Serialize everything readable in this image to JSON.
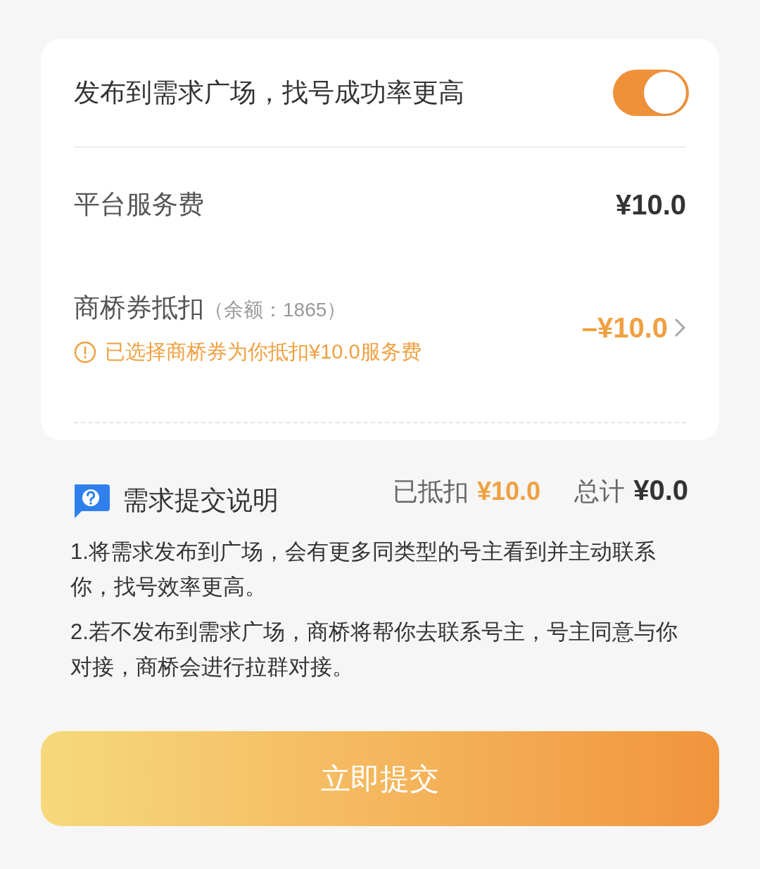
{
  "toggle_row": {
    "label": "发布到需求广场，找号成功率更高",
    "on": true
  },
  "fee_row": {
    "label": "平台服务费",
    "value": "¥10.0"
  },
  "coupon_row": {
    "label": "商桥券抵扣",
    "balance": "（余额：1865）",
    "notice": "已选择商桥券为你抵扣¥10.0服务费",
    "value": "–¥10.0"
  },
  "summary": {
    "help_title": "需求提交说明",
    "deducted_label": "已抵扣",
    "deducted_value": "¥10.0",
    "total_label": "总计",
    "total_value": "¥0.0"
  },
  "notes": [
    "1.将需求发布到广场，会有更多同类型的号主看到并主动联系你，找号效率更高。",
    "2.若不发布到需求广场，商桥将帮你去联系号主，号主同意与你对接，商桥会进行拉群对接。"
  ],
  "submit_button": "立即提交"
}
